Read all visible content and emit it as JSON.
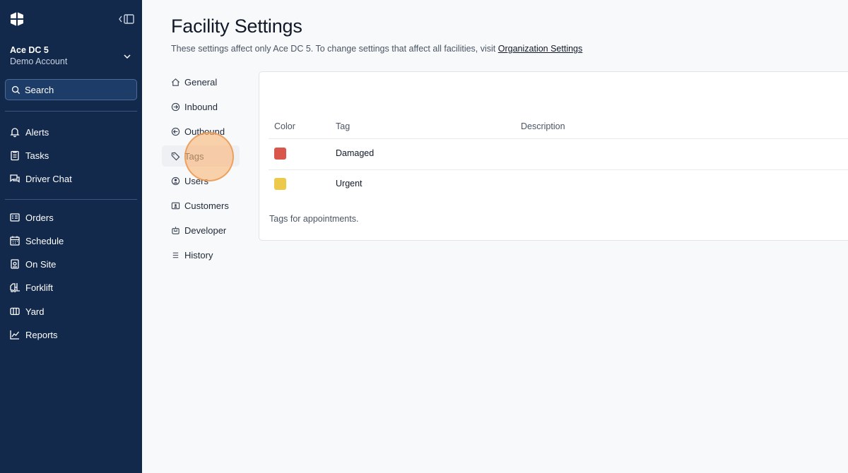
{
  "sidebar": {
    "account_name": "Ace DC 5",
    "account_sub": "Demo Account",
    "search_placeholder": "Search",
    "nav_group1": [
      "Alerts",
      "Tasks",
      "Driver Chat"
    ],
    "nav_group2": [
      "Orders",
      "Schedule",
      "On Site",
      "Forklift",
      "Yard",
      "Reports"
    ]
  },
  "page": {
    "title": "Facility Settings",
    "subtitle_prefix": "These settings affect only Ace DC 5. To change settings that affect all facilities, visit ",
    "subtitle_link": "Organization Settings"
  },
  "subnav": {
    "items": [
      "General",
      "Inbound",
      "Outbound",
      "Tags",
      "Users",
      "Customers",
      "Developer",
      "History"
    ],
    "active": "Tags"
  },
  "tags_table": {
    "headers": {
      "color": "Color",
      "tag": "Tag",
      "description": "Description"
    },
    "rows": [
      {
        "color": "#d9574a",
        "tag": "Damaged",
        "description": ""
      },
      {
        "color": "#ecc94b",
        "tag": "Urgent",
        "description": ""
      }
    ],
    "footer": "Tags for appointments."
  },
  "theme": {
    "sidebar_bg": "#13294b",
    "click_highlight": "#f9b778"
  }
}
